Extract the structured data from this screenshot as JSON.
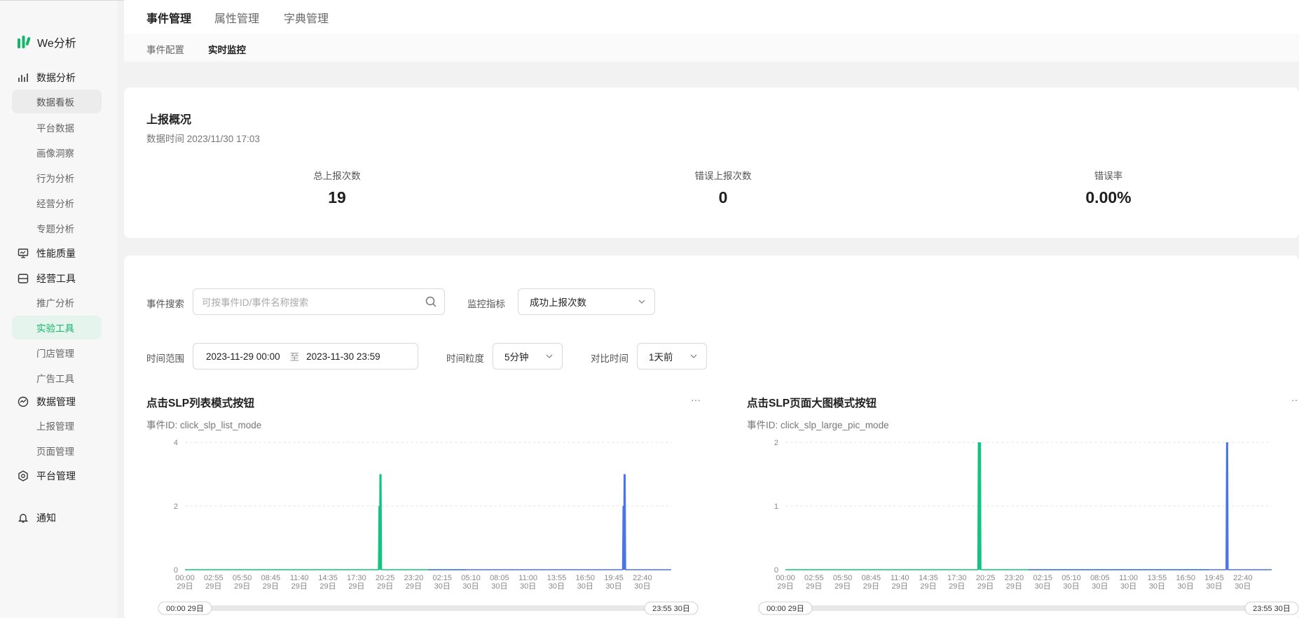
{
  "app": {
    "logo_text": "We分析"
  },
  "sidebar": {
    "groups": [
      {
        "label": "数据分析",
        "icon": "bar-chart-icon"
      },
      {
        "label": "性能质量",
        "icon": "monitor-icon"
      },
      {
        "label": "经营工具",
        "icon": "inbox-icon"
      },
      {
        "label": "数据管理",
        "icon": "pulse-icon"
      },
      {
        "label": "平台管理",
        "icon": "hexagon-gear-icon"
      }
    ],
    "items": [
      "数据看板",
      "平台数据",
      "画像洞察",
      "行为分析",
      "经营分析",
      "专题分析",
      "推广分析",
      "实验工具",
      "门店管理",
      "广告工具",
      "上报管理",
      "页面管理"
    ],
    "notify": "通知"
  },
  "tabs": {
    "top": [
      "事件管理",
      "属性管理",
      "字典管理"
    ],
    "sub": [
      "事件配置",
      "实时监控"
    ]
  },
  "overview": {
    "title": "上报概况",
    "time": "数据时间 2023/11/30 17:03",
    "stats": [
      {
        "label": "总上报次数",
        "value": "19"
      },
      {
        "label": "错误上报次数",
        "value": "0"
      },
      {
        "label": "错误率",
        "value": "0.00%"
      }
    ]
  },
  "filters": {
    "search_label": "事件搜索",
    "search_placeholder": "可按事件ID/事件名称搜索",
    "metric_label": "监控指标",
    "metric_value": "成功上报次数",
    "range_label": "时间范围",
    "range_start": "2023-11-29 00:00",
    "range_sep": "至",
    "range_end": "2023-11-30 23:59",
    "granularity_label": "时间粒度",
    "granularity_value": "5分钟",
    "compare_label": "对比时间",
    "compare_value": "1天前"
  },
  "colors": {
    "accent": "#12b76a",
    "current": "#12c47f",
    "compare": "#4a74e8"
  },
  "chart_data": [
    {
      "type": "line",
      "title": "点击SLP列表模式按钮",
      "event_id": "事件ID: click_slp_list_mode",
      "more": "···",
      "ylim": [
        0,
        4
      ],
      "yticks": [
        "0",
        "2",
        "4"
      ],
      "x_ticks": [
        [
          "00:00",
          "29日"
        ],
        [
          "02:55",
          "29日"
        ],
        [
          "05:50",
          "29日"
        ],
        [
          "08:45",
          "29日"
        ],
        [
          "11:40",
          "29日"
        ],
        [
          "14:35",
          "29日"
        ],
        [
          "17:30",
          "29日"
        ],
        [
          "20:25",
          "29日"
        ],
        [
          "23:20",
          "29日"
        ],
        [
          "02:15",
          "30日"
        ],
        [
          "05:10",
          "30日"
        ],
        [
          "08:05",
          "30日"
        ],
        [
          "11:00",
          "30日"
        ],
        [
          "13:55",
          "30日"
        ],
        [
          "16:50",
          "30日"
        ],
        [
          "19:45",
          "30日"
        ],
        [
          "22:40",
          "30日"
        ]
      ],
      "grid": true,
      "series": [
        {
          "color": "#12c47f",
          "points": [
            [
              0,
              0
            ],
            [
              19.1,
              0
            ],
            [
              19.15,
              2
            ],
            [
              19.2,
              0
            ],
            [
              19.25,
              3
            ],
            [
              19.3,
              0
            ],
            [
              19.35,
              3
            ],
            [
              19.4,
              0
            ],
            [
              24.0,
              0
            ],
            [
              27.8,
              0
            ]
          ]
        },
        {
          "color": "#4a74e8",
          "points": [
            [
              24.0,
              0
            ],
            [
              43.2,
              0
            ],
            [
              43.25,
              2
            ],
            [
              43.3,
              0
            ],
            [
              43.35,
              3
            ],
            [
              43.4,
              0
            ],
            [
              43.45,
              3
            ],
            [
              43.5,
              0
            ],
            [
              48.0,
              0
            ]
          ]
        }
      ],
      "slider": {
        "start": "00:00 29日",
        "end": "23:55 30日"
      }
    },
    {
      "type": "line",
      "title": "点击SLP页面大图模式按钮",
      "event_id": "事件ID: click_slp_large_pic_mode",
      "more": "···",
      "ylim": [
        0,
        2
      ],
      "yticks": [
        "0",
        "1",
        "2"
      ],
      "x_ticks": [
        [
          "00:00",
          "29日"
        ],
        [
          "02:55",
          "29日"
        ],
        [
          "05:50",
          "29日"
        ],
        [
          "08:45",
          "29日"
        ],
        [
          "11:40",
          "29日"
        ],
        [
          "14:35",
          "29日"
        ],
        [
          "17:30",
          "29日"
        ],
        [
          "20:25",
          "29日"
        ],
        [
          "23:20",
          "29日"
        ],
        [
          "02:15",
          "30日"
        ],
        [
          "05:10",
          "30日"
        ],
        [
          "08:05",
          "30日"
        ],
        [
          "11:00",
          "30日"
        ],
        [
          "13:55",
          "30日"
        ],
        [
          "16:50",
          "30日"
        ],
        [
          "19:45",
          "30日"
        ],
        [
          "22:40",
          "30日"
        ]
      ],
      "grid": true,
      "series": [
        {
          "color": "#12c47f",
          "points": [
            [
              0,
              0
            ],
            [
              19.0,
              0
            ],
            [
              19.05,
              2
            ],
            [
              19.1,
              0
            ],
            [
              19.15,
              2
            ],
            [
              19.2,
              0
            ],
            [
              19.25,
              2
            ],
            [
              19.3,
              0
            ],
            [
              24.0,
              0
            ],
            [
              41.8,
              0
            ]
          ]
        },
        {
          "color": "#4a74e8",
          "points": [
            [
              24.0,
              0
            ],
            [
              43.5,
              0
            ],
            [
              43.55,
              2
            ],
            [
              43.6,
              0
            ],
            [
              43.65,
              2
            ],
            [
              43.7,
              0
            ],
            [
              48.0,
              0
            ]
          ]
        }
      ],
      "slider": {
        "start": "00:00 29日",
        "end": "23:55 30日"
      }
    }
  ]
}
